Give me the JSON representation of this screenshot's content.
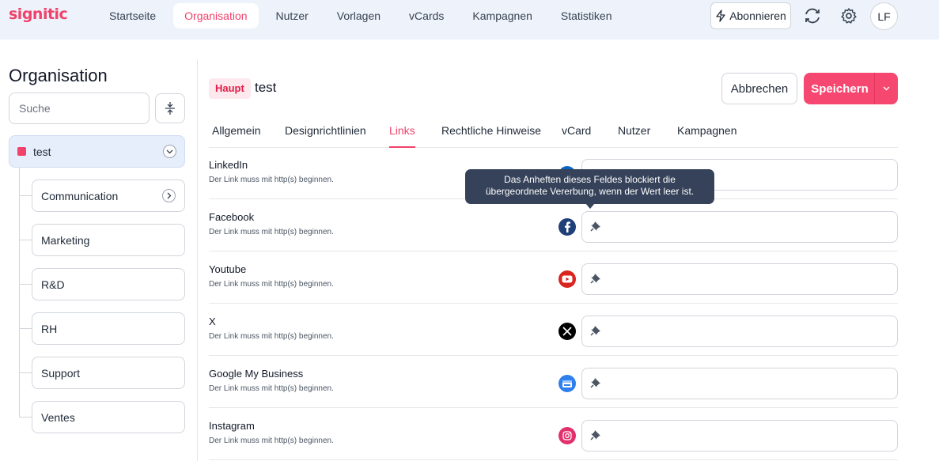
{
  "app": {
    "logo_text": "signitic"
  },
  "nav": {
    "items": [
      "Startseite",
      "Organisation",
      "Nutzer",
      "Vorlagen",
      "vCards",
      "Kampagnen",
      "Statistiken"
    ],
    "active": "Organisation",
    "subscribe_label": "Abonnieren",
    "avatar_initials": "LF"
  },
  "sidebar": {
    "title": "Organisation",
    "search_placeholder": "Suche",
    "root": {
      "label": "test",
      "color": "#f0426b"
    },
    "children": [
      "Communication",
      "Marketing",
      "R&D",
      "RH",
      "Support",
      "Ventes"
    ]
  },
  "main": {
    "badge": "Haupt",
    "title": "test",
    "cancel_label": "Abbrechen",
    "save_label": "Speichern",
    "tabs": [
      "Allgemein",
      "Designrichtlinien",
      "Links",
      "Rechtliche Hinweise",
      "vCard",
      "Nutzer",
      "Kampagnen"
    ],
    "active_tab": "Links",
    "links": [
      {
        "label": "LinkedIn",
        "hint": "Der Link muss mit http(s) beginnen.",
        "icon": "linkedin-icon",
        "value": ""
      },
      {
        "label": "Facebook",
        "hint": "Der Link muss mit http(s) beginnen.",
        "icon": "facebook-icon",
        "value": ""
      },
      {
        "label": "Youtube",
        "hint": "Der Link muss mit http(s) beginnen.",
        "icon": "youtube-icon",
        "value": ""
      },
      {
        "label": "X",
        "hint": "Der Link muss mit http(s) beginnen.",
        "icon": "x-icon",
        "value": ""
      },
      {
        "label": "Google My Business",
        "hint": "Der Link muss mit http(s) beginnen.",
        "icon": "google-my-business-icon",
        "value": ""
      },
      {
        "label": "Instagram",
        "hint": "Der Link muss mit http(s) beginnen.",
        "icon": "instagram-icon",
        "value": ""
      }
    ],
    "tooltip_line1": "Das Anheften dieses Feldes blockiert die",
    "tooltip_line2": "übergeordnete Vererbung, wenn der Wert leer ist."
  },
  "colors": {
    "brand": "#f0426b",
    "topbar": "#eef3fb",
    "tooltip": "#354259"
  }
}
